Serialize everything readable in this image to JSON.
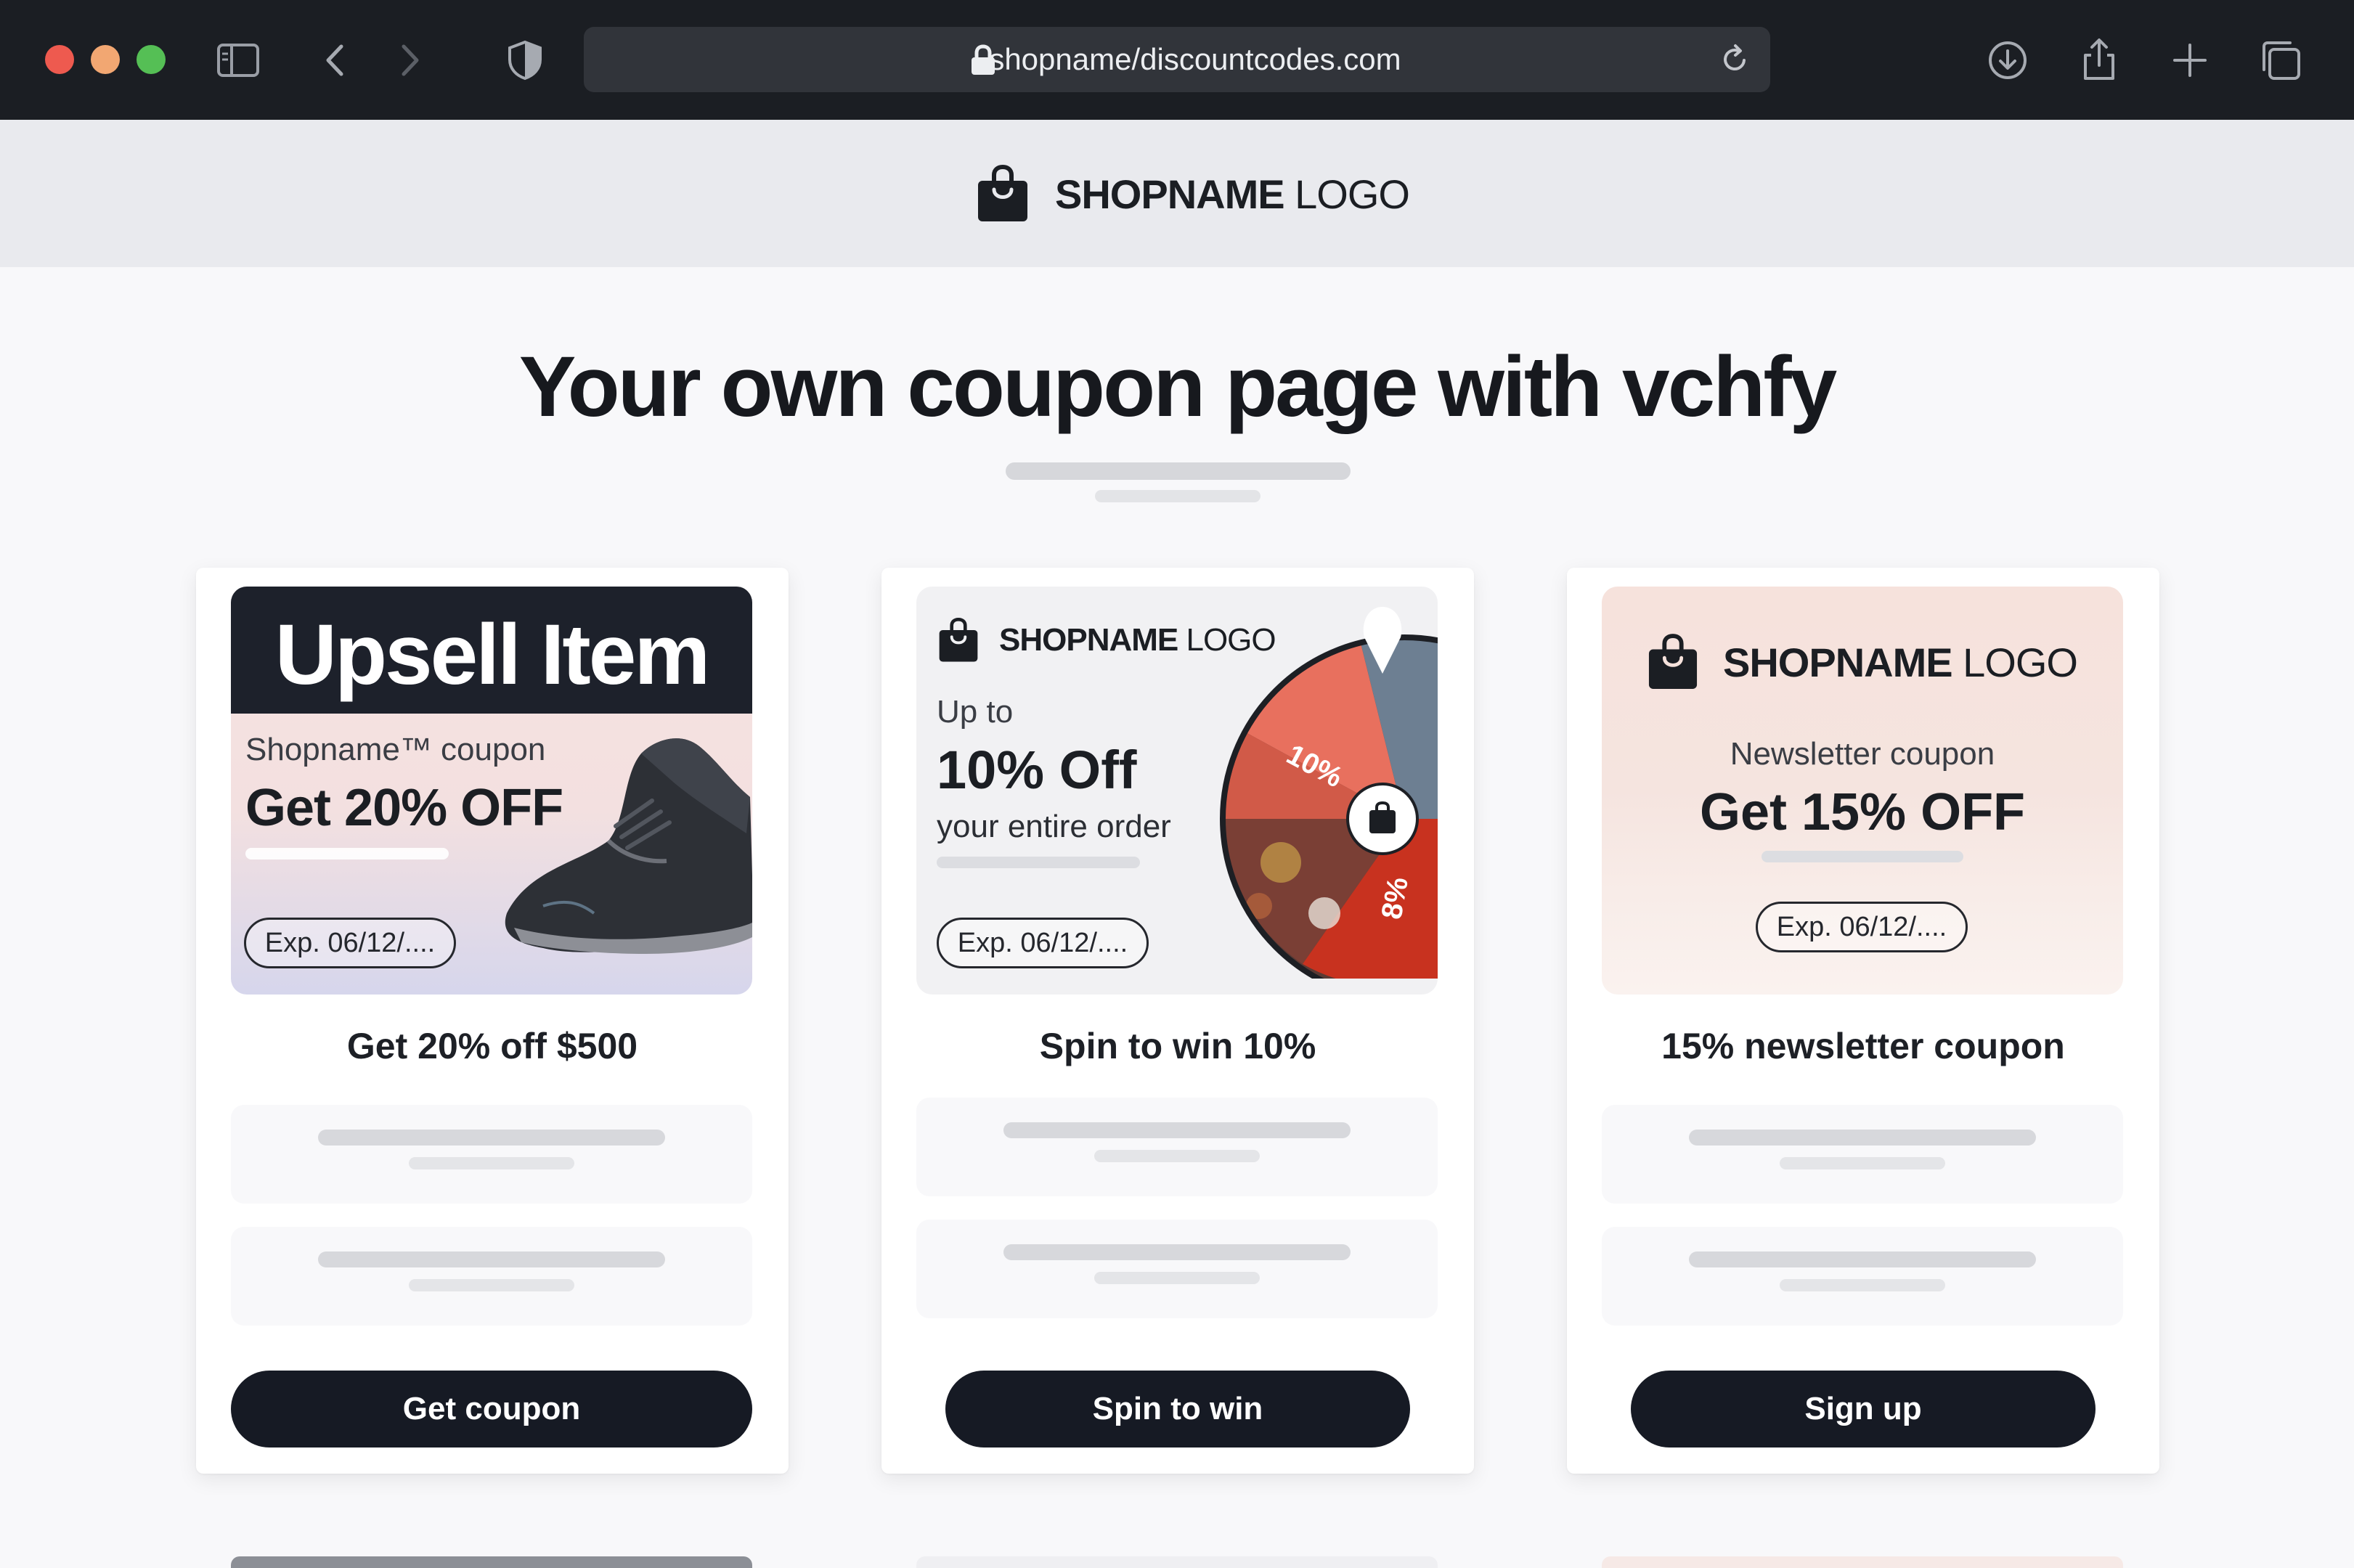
{
  "browser": {
    "url": "shopname/discountcodes.com",
    "icons": [
      "sidebar-icon",
      "back-icon",
      "forward-icon",
      "shield-icon",
      "lock-icon",
      "reload-icon",
      "download-icon",
      "share-icon",
      "new-tab-icon",
      "tabs-overview-icon"
    ]
  },
  "header": {
    "brand_bold": "SHOPNAME",
    "brand_light": "LOGO"
  },
  "hero": {
    "title": "Your own coupon page with vchfy"
  },
  "cards": [
    {
      "banner_title": "Upsell Item",
      "subtitle": "Shopname™ coupon",
      "offer": "Get 20% OFF",
      "expiry": "Exp. 06/12/....",
      "title": "Get 20% off $500",
      "cta": "Get coupon"
    },
    {
      "brand_bold": "SHOPNAME",
      "brand_light": "LOGO",
      "upto": "Up to",
      "offer": "10% Off",
      "detail": "your entire order",
      "expiry": "Exp. 06/12/....",
      "wheel_labels": [
        "10%",
        "8%"
      ],
      "title": "Spin to win 10%",
      "cta": "Spin to win"
    },
    {
      "brand_bold": "SHOPNAME",
      "brand_light": "LOGO",
      "subtitle": "Newsletter coupon",
      "offer": "Get 15% OFF",
      "expiry": "Exp. 06/12/....",
      "title": "15% newsletter coupon",
      "cta": "Sign up"
    }
  ],
  "colors": {
    "chrome_bg": "#1b1e23",
    "header_bg": "#e9eaee",
    "button_bg": "#161a24",
    "wheel_red": "#c8321f",
    "wheel_salmon": "#e8705e"
  }
}
